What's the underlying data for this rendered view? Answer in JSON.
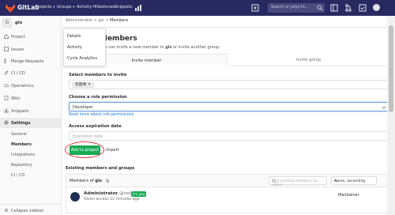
{
  "topbar": {
    "brand": "GitLab",
    "nav": [
      "Projects",
      "Groups",
      "Activity",
      "Milestones",
      "Snippets"
    ],
    "search_placeholder": "Search or jump to...",
    "icons": [
      "gitlab-logo-icon",
      "chart-icon",
      "plus-icon",
      "sidebar-toggle-icon",
      "merge-request-icon",
      "check-icon",
      "user-avatar"
    ]
  },
  "sidebar": {
    "group_initial": "G",
    "group_name": "gis",
    "items": [
      {
        "label": "Project",
        "icon": "home-icon"
      },
      {
        "label": "Issues",
        "icon": "issues-icon"
      },
      {
        "label": "Merge Requests",
        "icon": "merge-request-icon"
      },
      {
        "label": "CI / CD",
        "icon": "rocket-icon"
      },
      {
        "label": "Operations",
        "icon": "cloud-icon"
      },
      {
        "label": "Wiki",
        "icon": "book-icon"
      },
      {
        "label": "Snippets",
        "icon": "scissors-icon"
      },
      {
        "label": "Settings",
        "icon": "gear-icon"
      }
    ],
    "sub_items": [
      "General",
      "Members",
      "Integrations",
      "Repository",
      "CI / CD"
    ],
    "collapse_label": "Collapse sidebar"
  },
  "breadcrumb": {
    "parts": [
      "Administrator",
      "gis",
      "Members"
    ]
  },
  "dropdown": {
    "items": [
      "Details",
      "Activity",
      "Cycle Analytics"
    ]
  },
  "page": {
    "title": "Members",
    "subtitle_prefix": "You can invite a new member to",
    "subtitle_project": "gis",
    "subtitle_suffix": "or invite another group."
  },
  "tabs": {
    "invite_member": "Invite member",
    "invite_group": "Invite group"
  },
  "form": {
    "select_label": "Select members to invite",
    "selected_token": "张国禹",
    "role_label": "Choose a role permission",
    "role_value": "Developer",
    "role_link": "Read more about role permissions",
    "expiration_label": "Access expiration date",
    "expiration_placeholder": "Expiration date",
    "add_button": "Add to project",
    "import_button": "Import"
  },
  "existing": {
    "section_title": "Existing members and groups",
    "panel_title": "Members of",
    "panel_project": "gis",
    "count": "1",
    "filter_placeholder": "Find existing members by name",
    "sort_label": "Name, ascending",
    "members": [
      {
        "name": "Administrator",
        "username": "@root",
        "badge": "It's you",
        "granted": "Given access 22 minutes ago",
        "role": "Maintainer"
      }
    ]
  }
}
